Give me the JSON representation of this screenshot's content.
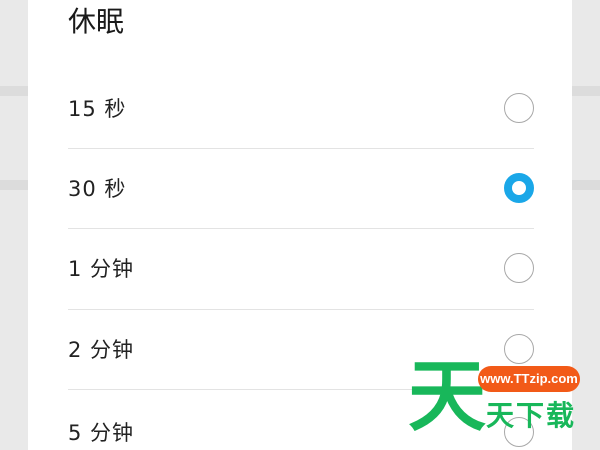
{
  "dialog": {
    "title": "休眠",
    "options": [
      {
        "label": "15 秒",
        "selected": false
      },
      {
        "label": "30 秒",
        "selected": true
      },
      {
        "label": "1 分钟",
        "selected": false
      },
      {
        "label": "2 分钟",
        "selected": false
      },
      {
        "label": "5 分钟",
        "selected": false
      }
    ]
  },
  "watermark": {
    "glyph": "天",
    "url": "www.TTzip.com",
    "text": "天下载"
  },
  "colors": {
    "accent": "#1aa7e8",
    "watermark_green": "#18b75a",
    "watermark_orange": "#f25a18"
  }
}
